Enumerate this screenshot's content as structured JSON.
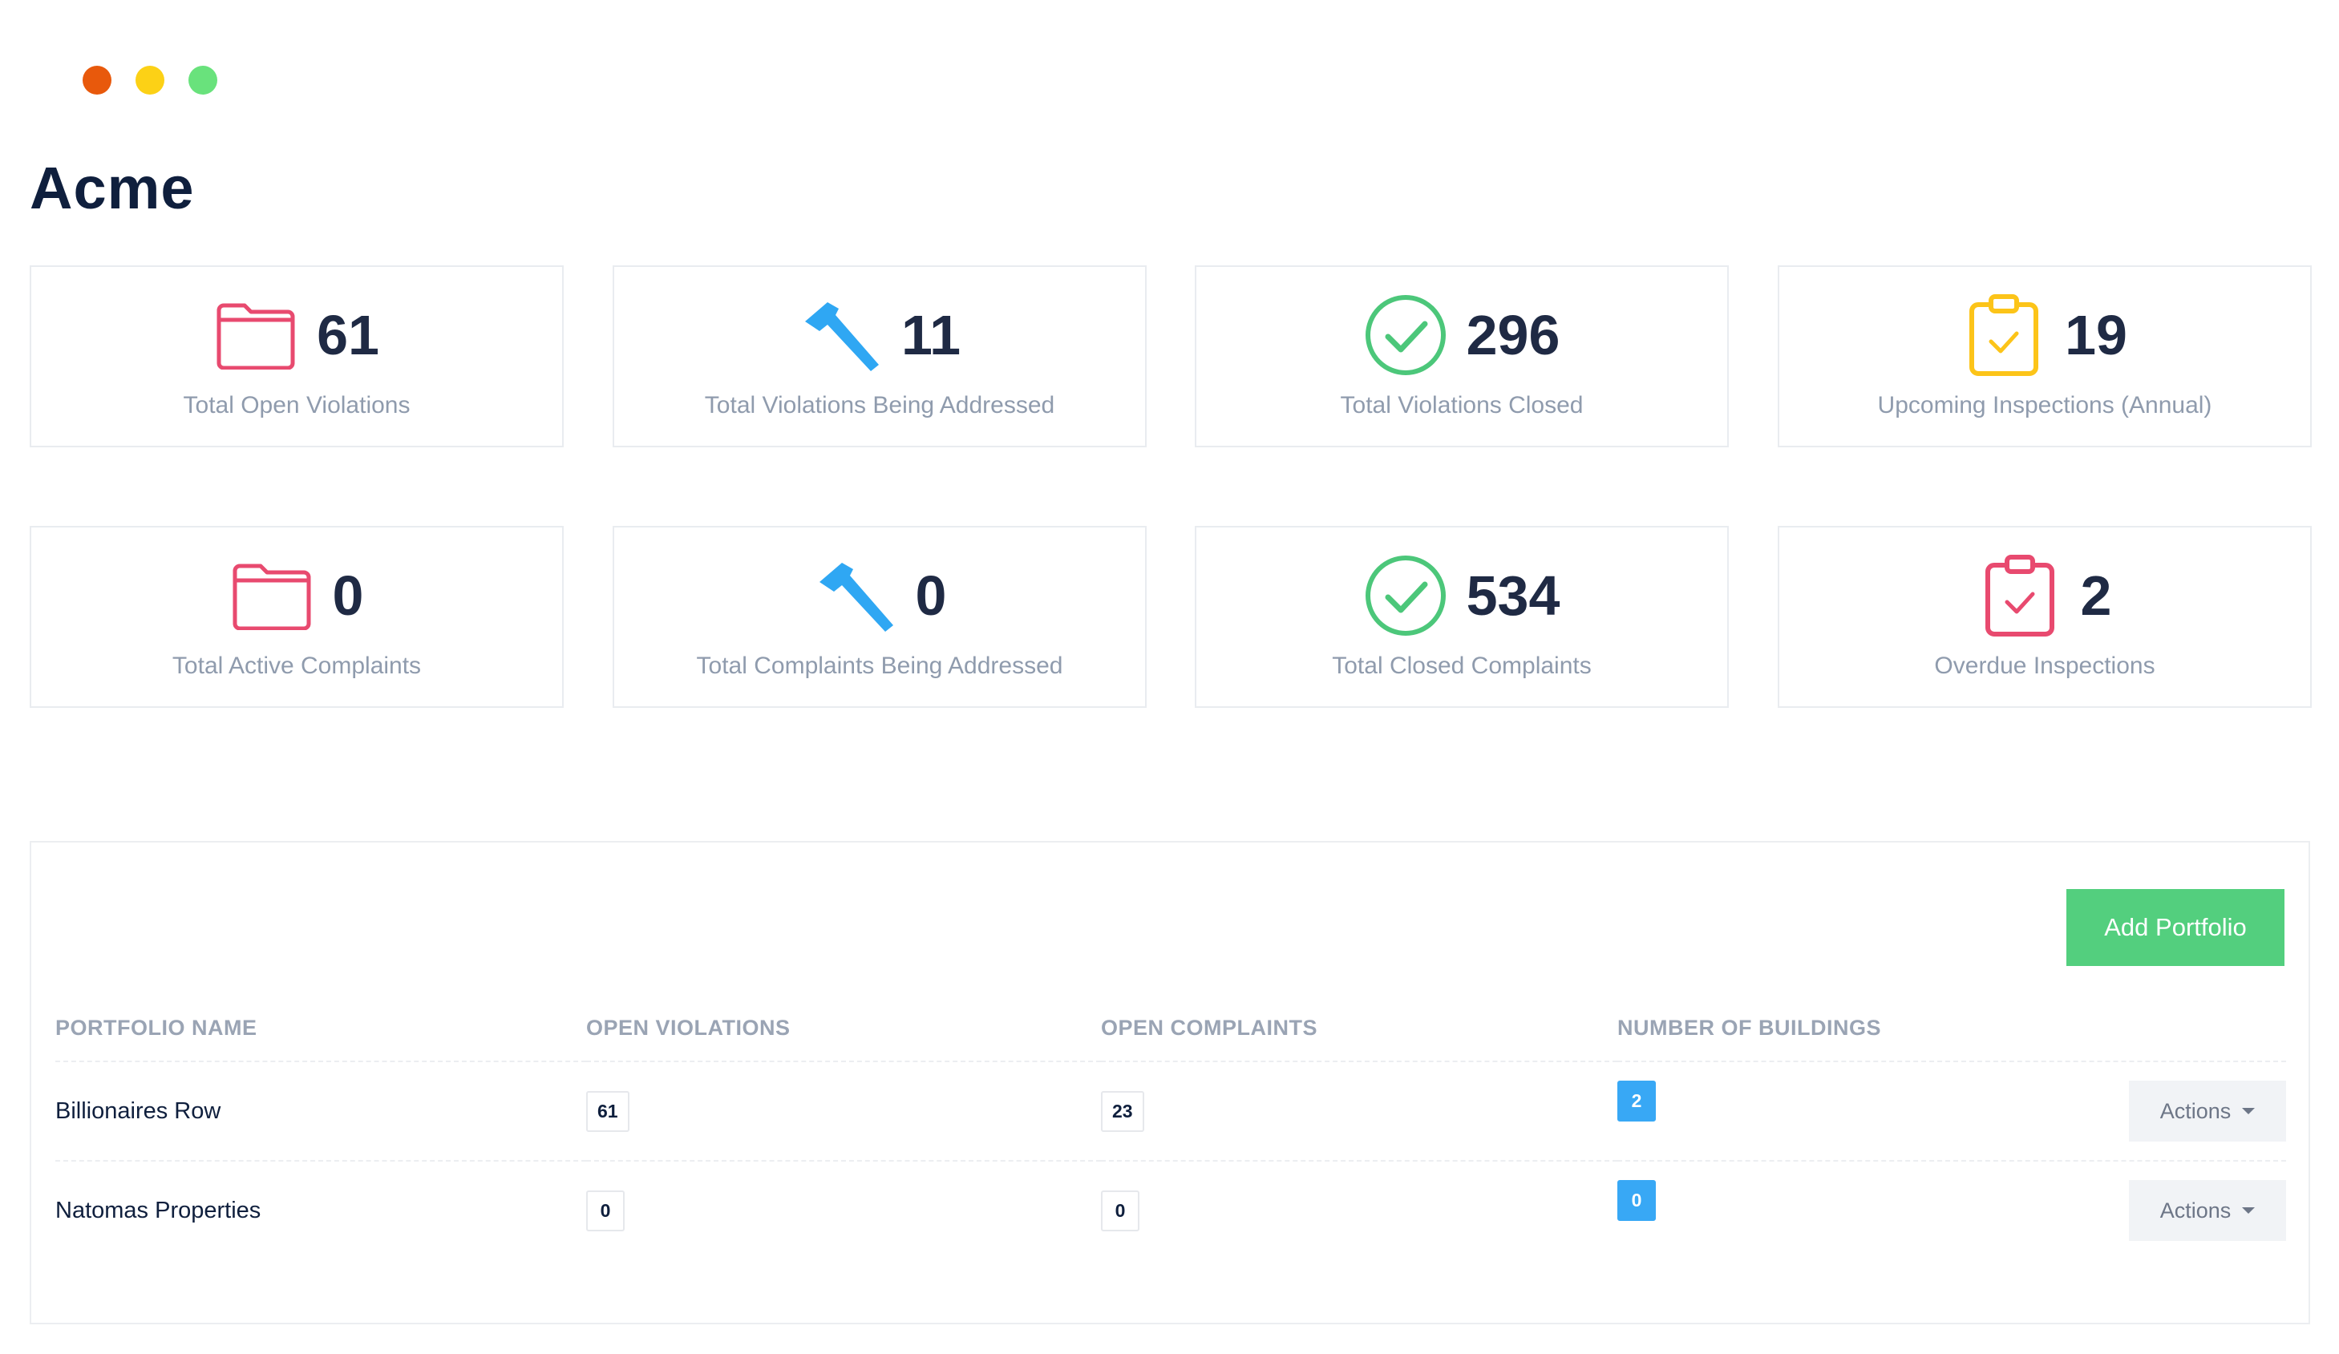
{
  "app": {
    "title": "Acme"
  },
  "colors": {
    "folder": "#e84a6f",
    "hammer": "#2fa7f3",
    "check": "#4cc77a",
    "clipboard_yellow": "#fcc419",
    "clipboard_red": "#e84a6f",
    "add_button": "#53cf7e",
    "badge_blue": "#38a8f5"
  },
  "stats": [
    {
      "icon": "folder-icon",
      "value": "61",
      "label": "Total Open Violations"
    },
    {
      "icon": "hammer-icon",
      "value": "11",
      "label": "Total Violations Being Addressed"
    },
    {
      "icon": "check-circle-icon",
      "value": "296",
      "label": "Total Violations Closed"
    },
    {
      "icon": "clipboard-check-icon",
      "value": "19",
      "label": "Upcoming Inspections (Annual)"
    },
    {
      "icon": "folder-icon",
      "value": "0",
      "label": "Total Active Complaints"
    },
    {
      "icon": "hammer-icon",
      "value": "0",
      "label": "Total Complaints Being Addressed"
    },
    {
      "icon": "check-circle-icon",
      "value": "534",
      "label": "Total Closed Complaints"
    },
    {
      "icon": "clipboard-check-icon",
      "value": "2",
      "label": "Overdue Inspections"
    }
  ],
  "portfolio": {
    "add_button_label": "Add Portfolio",
    "columns": [
      "PORTFOLIO NAME",
      "OPEN VIOLATIONS",
      "OPEN COMPLAINTS",
      "NUMBER OF BUILDINGS"
    ],
    "rows": [
      {
        "name": "Billionaires Row",
        "open_violations": "61",
        "open_complaints": "23",
        "buildings": "2",
        "actions_label": "Actions"
      },
      {
        "name": "Natomas Properties",
        "open_violations": "0",
        "open_complaints": "0",
        "buildings": "0",
        "actions_label": "Actions"
      }
    ]
  }
}
